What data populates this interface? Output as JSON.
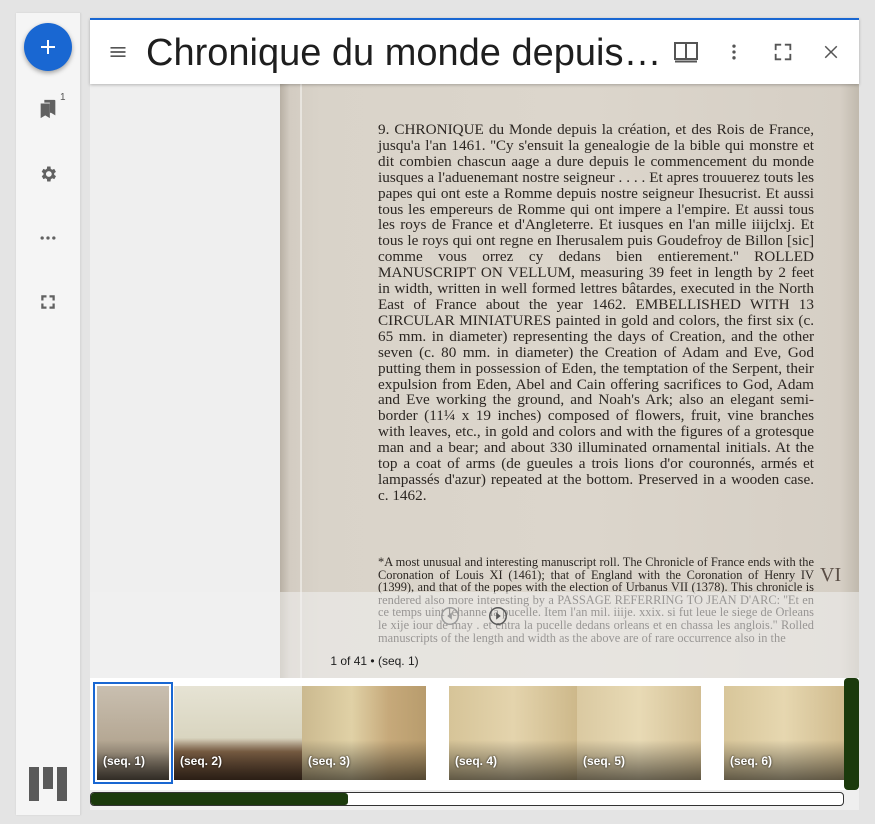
{
  "rail": {
    "add_icon": "plus-icon",
    "bookmarks_badge": "1",
    "icons": [
      "bookmarks-icon",
      "gear-icon",
      "more-horizontal-icon",
      "fullscreen-icon",
      "mirador-logo-icon"
    ]
  },
  "window": {
    "title": "Chronique du monde depuis la création, et des Rois de France",
    "icons": [
      "menu-icon",
      "book-view-icon",
      "more-vertical-icon",
      "maximize-icon",
      "close-icon"
    ]
  },
  "page": {
    "main_text": "9. CHRONIQUE du Monde depuis la création, et des Rois de France, jusqu'a l'an 1461.  ''Cy s'ensuit la genealogie de la bible qui monstre et dit combien chascun aage a dure depuis le commencement du monde iusques a l'aduenemant nostre seigneur . . . . Et apres trouuerez touts les papes qui ont este a Romme depuis nostre seigneur Ihesucrist.  Et aussi tous les empereurs de Romme qui ont impere a l'empire.  Et aussi tous les roys de France et d'Angleterre.  Et iusques en l'an mille iiijclxj.  Et tous le roys qui ont regne en Iherusalem puis Goudefroy de Billon [sic] comme vous orrez cy dedans bien entierement.''  ROLLED MANUSCRIPT ON VELLUM, measuring 39 feet in length by 2 feet in width, written in well formed lettres bâtardes, executed in the North East of France about the year 1462.  EMBELLISHED WITH 13 CIRCULAR MINIATURES painted in gold and colors, the first six (c. 65 mm. in diameter) representing the days of Creation, and the other seven (c. 80 mm. in diameter) the Creation of Adam and Eve, God putting them in possession of Eden, the temptation of the Serpent, their expulsion from Eden, Abel and Cain offering sacrifices to God, Adam and Eve working the ground, and Noah's Ark; also an elegant semi-border (11¼ x 19 inches) composed of flowers, fruit, vine branches with leaves, etc., in gold and colors and with the figures of a grotesque man and a bear; and about 330 illuminated ornamental initials.  At the top a coat of arms (de gueules a trois lions d'or couronnés, armés et lampassés d'azur) repeated at the bottom.  Preserved in a wooden case.                    c. 1462.",
    "note_text": "*A most unusual and interesting manuscript roll.  The Chronicle of France ends with the Coronation of Louis XI (1461); that of England with the Coronation of Henry IV (1399), and that of the popes with the election of Urbanus VII (1378).  This chronicle is rendered also more interesting by a PASSAGE REFERRING TO JEAN D'ARC:  ''Et en ce temps uint Iehanne la pucelle.  Item l'an mil. iiije. xxix. si fut leue le siege de Orleans le xije iour de may . et entra la pucelle dedans orleans et en chassa les anglois.''  Rolled manuscripts of the length and width as the above are of rare occurrence also in the",
    "margin_note": "VI"
  },
  "controls": {
    "prev_icon": "rotate-left-icon",
    "next_icon": "play-icon",
    "seq_label": "1 of 41 • (seq. 1)"
  },
  "thumbnails": [
    {
      "label": "(seq. 1)",
      "selected": true
    },
    {
      "label": "(seq. 2)",
      "selected": false
    },
    {
      "label": "(seq. 3)",
      "selected": false
    },
    {
      "label": "(seq. 4)",
      "selected": false
    },
    {
      "label": "(seq. 5)",
      "selected": false
    },
    {
      "label": "(seq. 6)",
      "selected": false
    }
  ],
  "scroll": {
    "horizontal_position": 0.34
  },
  "colors": {
    "accent": "#1967d2",
    "scrollbar": "#1b3a0c"
  }
}
